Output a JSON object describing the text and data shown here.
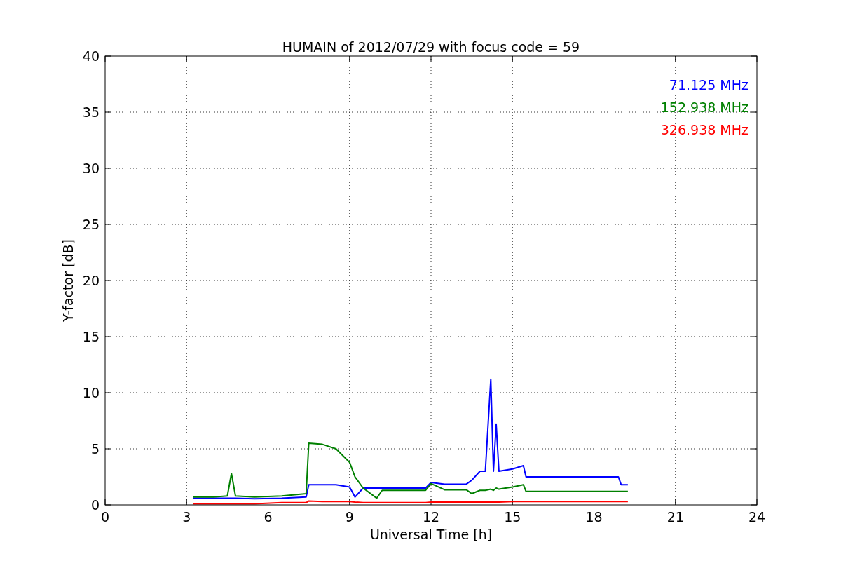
{
  "chart_data": {
    "type": "line",
    "title": "HUMAIN of 2012/07/29 with focus code = 59",
    "xlabel": "Universal Time [h]",
    "ylabel": "Y-factor [dB]",
    "x": [
      3.25,
      4.0,
      4.5,
      4.65,
      4.8,
      5.5,
      6.5,
      7.4,
      7.5,
      8.0,
      8.5,
      9.0,
      9.2,
      9.5,
      10.0,
      10.2,
      11.8,
      12.0,
      12.5,
      13.3,
      13.5,
      13.8,
      14.0,
      14.2,
      14.3,
      14.4,
      14.5,
      15.0,
      15.4,
      15.5,
      17.0,
      18.9,
      19.0,
      19.25
    ],
    "series": [
      {
        "name": "71.125 MHz",
        "color": "#0000ff",
        "values": [
          0.6,
          0.6,
          0.6,
          0.6,
          0.6,
          0.55,
          0.6,
          0.7,
          1.8,
          1.8,
          1.8,
          1.6,
          0.7,
          1.5,
          1.5,
          1.5,
          1.5,
          2.0,
          1.85,
          1.85,
          2.2,
          3.0,
          3.0,
          11.2,
          3.0,
          7.2,
          3.0,
          3.2,
          3.5,
          2.5,
          2.5,
          2.5,
          1.8,
          1.8
        ]
      },
      {
        "name": "152.938 MHz",
        "color": "#008000",
        "values": [
          0.7,
          0.7,
          0.8,
          2.8,
          0.8,
          0.7,
          0.8,
          1.0,
          5.5,
          5.4,
          5.0,
          3.8,
          2.5,
          1.5,
          0.6,
          1.3,
          1.3,
          1.9,
          1.35,
          1.35,
          1.0,
          1.3,
          1.3,
          1.4,
          1.3,
          1.5,
          1.4,
          1.6,
          1.8,
          1.2,
          1.2,
          1.2,
          1.2,
          1.2
        ]
      },
      {
        "name": "326.938 MHz",
        "color": "#ff0000",
        "values": [
          0.1,
          0.1,
          0.1,
          0.1,
          0.1,
          0.1,
          0.2,
          0.2,
          0.35,
          0.3,
          0.3,
          0.3,
          0.25,
          0.2,
          0.2,
          0.2,
          0.2,
          0.25,
          0.25,
          0.25,
          0.25,
          0.25,
          0.25,
          0.25,
          0.25,
          0.25,
          0.25,
          0.3,
          0.3,
          0.3,
          0.3,
          0.3,
          0.3,
          0.3
        ]
      }
    ],
    "grid": true,
    "xlim": [
      0,
      24
    ],
    "ylim": [
      0,
      40
    ],
    "xticks": [
      0,
      3,
      6,
      9,
      12,
      15,
      18,
      21,
      24
    ],
    "yticks": [
      0,
      5,
      10,
      15,
      20,
      25,
      30,
      35,
      40
    ]
  }
}
